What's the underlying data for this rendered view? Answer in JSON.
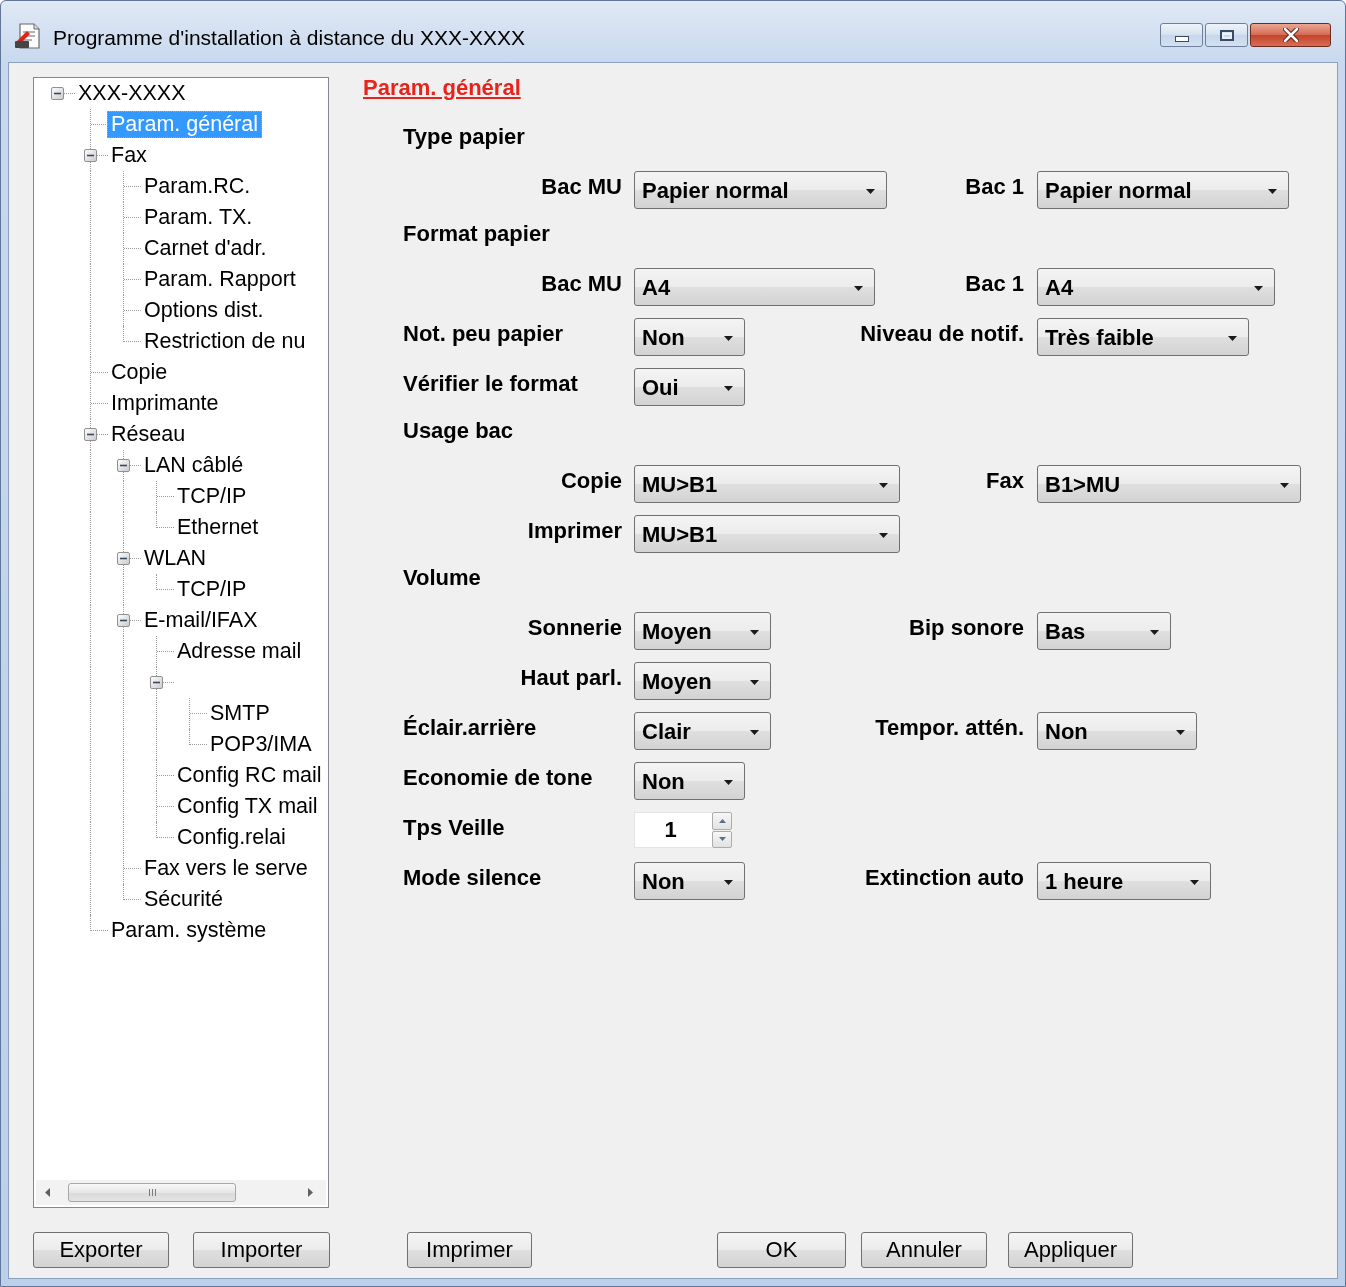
{
  "window": {
    "title": "Programme d'installation à distance du XXX-XXXX"
  },
  "tree": [
    {
      "label": "XXX-XXXX",
      "expanded": true,
      "selected": false,
      "children": [
        {
          "label": "Param. général",
          "selected": true
        },
        {
          "label": "Fax",
          "expanded": true,
          "selected": false,
          "children": [
            {
              "label": "Param.RC.",
              "selected": false
            },
            {
              "label": "Param. TX.",
              "selected": false
            },
            {
              "label": "Carnet d'adr.",
              "selected": false
            },
            {
              "label": "Param. Rapport",
              "selected": false
            },
            {
              "label": "Options dist.",
              "selected": false
            },
            {
              "label": "Restriction de nu",
              "selected": false
            }
          ]
        },
        {
          "label": "Copie",
          "selected": false
        },
        {
          "label": "Imprimante",
          "selected": false
        },
        {
          "label": "Réseau",
          "expanded": true,
          "selected": false,
          "children": [
            {
              "label": "LAN câblé",
              "expanded": true,
              "selected": false,
              "children": [
                {
                  "label": "TCP/IP",
                  "selected": false
                },
                {
                  "label": "Ethernet",
                  "selected": false
                }
              ]
            },
            {
              "label": "WLAN",
              "expanded": true,
              "selected": false,
              "children": [
                {
                  "label": "TCP/IP",
                  "selected": false
                }
              ]
            },
            {
              "label": "E-mail/IFAX",
              "expanded": true,
              "selected": false,
              "children": [
                {
                  "label": "Adresse mail",
                  "selected": false
                },
                {
                  "expanded": true,
                  "children": [
                    {
                      "label": "SMTP",
                      "selected": false
                    },
                    {
                      "label": "POP3/IMA",
                      "selected": false
                    }
                  ]
                },
                {
                  "label": "Config RC mail",
                  "selected": false
                },
                {
                  "label": "Config TX mail",
                  "selected": false
                },
                {
                  "label": "Config.relai",
                  "selected": false
                }
              ]
            },
            {
              "label": "Fax vers le serve",
              "selected": false
            },
            {
              "label": "Sécurité",
              "selected": false
            }
          ]
        },
        {
          "label": "Param. système",
          "selected": false
        }
      ]
    }
  ],
  "panel": {
    "title": "Param. général",
    "items": [
      {
        "kind": "group",
        "title": "Type papier",
        "rows": [
          {
            "fields": [
              {
                "label": "Bac MU",
                "kind": "combo",
                "value": "Papier normal"
              },
              {
                "label": "Bac 1",
                "kind": "combo",
                "value": "Papier normal"
              }
            ]
          }
        ]
      },
      {
        "kind": "group",
        "title": "Format papier",
        "rows": [
          {
            "fields": [
              {
                "label": "Bac MU",
                "kind": "combo",
                "value": "A4"
              },
              {
                "label": "Bac 1",
                "kind": "combo",
                "value": "A4"
              }
            ]
          }
        ]
      },
      {
        "kind": "row",
        "fields": [
          {
            "label": "Not. peu papier",
            "kind": "combo",
            "value": "Non"
          },
          {
            "label": "Niveau de notif.",
            "kind": "combo",
            "value": "Très faible"
          }
        ]
      },
      {
        "kind": "row",
        "fields": [
          {
            "label": "Vérifier le format",
            "kind": "combo",
            "value": "Oui"
          }
        ]
      },
      {
        "kind": "group",
        "title": "Usage bac",
        "rows": [
          {
            "fields": [
              {
                "label": "Copie",
                "kind": "combo",
                "value": "MU>B1"
              },
              {
                "label": "Fax",
                "kind": "combo",
                "value": "B1>MU"
              }
            ]
          },
          {
            "fields": [
              {
                "label": "Imprimer",
                "kind": "combo",
                "value": "MU>B1"
              }
            ]
          }
        ]
      },
      {
        "kind": "group",
        "title": "Volume",
        "rows": [
          {
            "fields": [
              {
                "label": "Sonnerie",
                "kind": "combo",
                "value": "Moyen"
              },
              {
                "label": "Bip sonore",
                "kind": "combo",
                "value": "Bas"
              }
            ]
          },
          {
            "fields": [
              {
                "label": "Haut parl.",
                "kind": "combo",
                "value": "Moyen"
              }
            ]
          }
        ]
      },
      {
        "kind": "row",
        "fields": [
          {
            "label": "Éclair.arrière",
            "kind": "combo",
            "value": "Clair"
          },
          {
            "label": "Tempor. attén.",
            "kind": "combo",
            "value": "Non"
          }
        ]
      },
      {
        "kind": "row",
        "fields": [
          {
            "label": "Economie de tone",
            "kind": "combo",
            "value": "Non"
          }
        ]
      },
      {
        "kind": "row",
        "fields": [
          {
            "label": "Tps Veille",
            "kind": "spinner",
            "value": "1"
          }
        ]
      },
      {
        "kind": "row",
        "fields": [
          {
            "label": "Mode silence",
            "kind": "combo",
            "value": "Non"
          },
          {
            "label": "Extinction auto",
            "kind": "combo",
            "value": "1 heure"
          }
        ]
      }
    ]
  },
  "buttons": [
    {
      "label": "Exporter"
    },
    {
      "label": "Importer"
    },
    {
      "label": "Imprimer"
    },
    {
      "label": "OK"
    },
    {
      "label": "Annuler"
    },
    {
      "label": "Appliquer"
    }
  ]
}
